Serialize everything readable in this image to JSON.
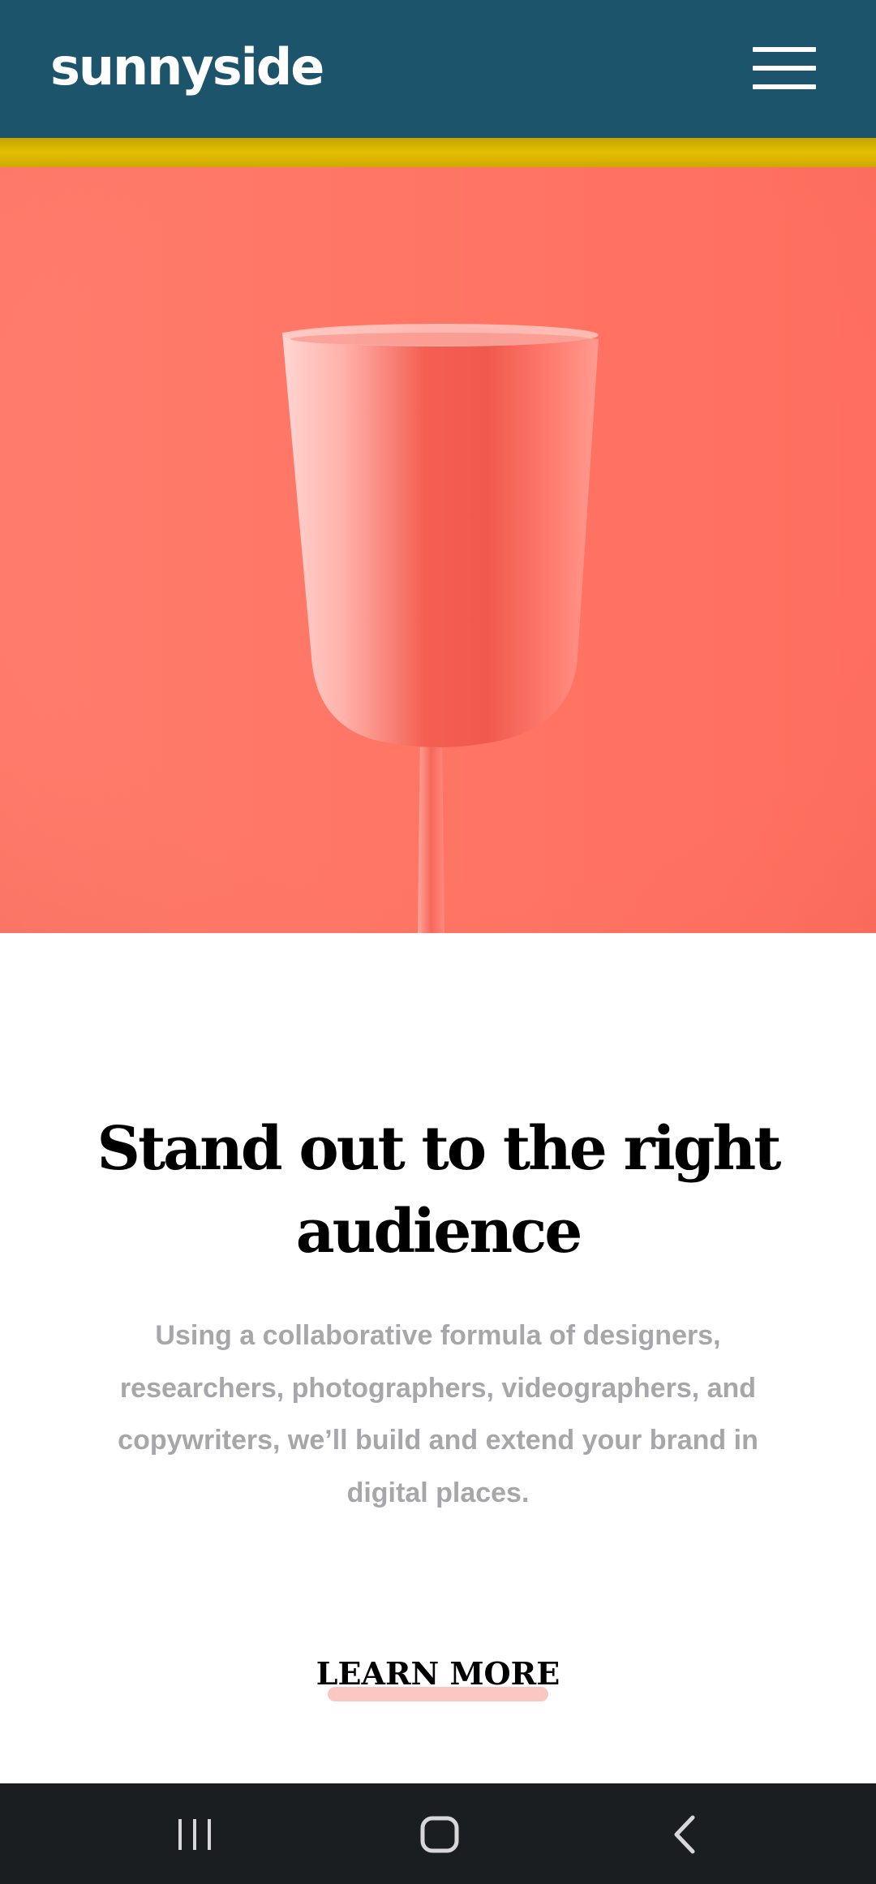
{
  "header": {
    "logo": "sunnyside",
    "menu_icon": "hamburger-menu-icon",
    "background_color": "#1c546c",
    "accent_stripe_color": "#e2bc00"
  },
  "hero": {
    "image": "pink-wine-glass-on-coral-background",
    "background_color": "#ff7563"
  },
  "main": {
    "headline_line1": "Stand out to the right",
    "headline_line2": "audience",
    "body": "Using a collaborative formula of designers, researchers, photographers, videographers, and copywriters, we’ll build and extend your brand in digital places.",
    "cta_label": "LEARN MORE",
    "cta_underline_color": "#fbc7c3"
  },
  "system_nav": {
    "recents_icon": "recent-apps-icon",
    "home_icon": "home-icon",
    "back_icon": "back-icon"
  }
}
